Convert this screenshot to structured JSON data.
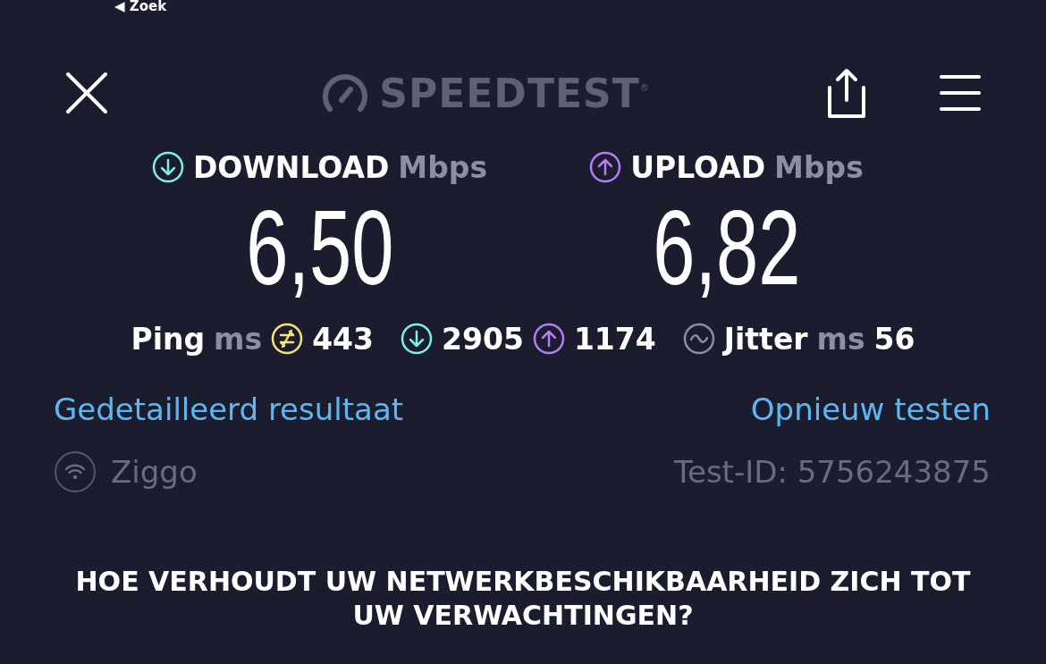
{
  "status_bar": {
    "back_arrow": "◀",
    "back_label": "Zoek"
  },
  "header": {
    "logo": "SPEEDTEST",
    "logo_mark": "®"
  },
  "results": [
    {
      "kind": "download",
      "label": "DOWNLOAD",
      "unit": "Mbps",
      "value": "6,50",
      "color": "#7ff0df"
    },
    {
      "kind": "upload",
      "label": "UPLOAD",
      "unit": "Mbps",
      "value": "6,82",
      "color": "#b47cf5"
    }
  ],
  "latency": {
    "ping_label": "Ping",
    "ping_unit": "ms",
    "ping": "443",
    "download_ping": "2905",
    "upload_ping": "1174",
    "jitter_label": "Jitter",
    "jitter_unit": "ms",
    "jitter": "56"
  },
  "links": {
    "detailed": "Gedetailleerd resultaat",
    "retest": "Opnieuw testen"
  },
  "provider": "Ziggo",
  "test_id": "Test-ID: 5756243875",
  "survey_question": "HOE VERHOUDT UW NETWERKBESCHIKBAARHEID ZICH TOT UW VERWACHTINGEN?"
}
